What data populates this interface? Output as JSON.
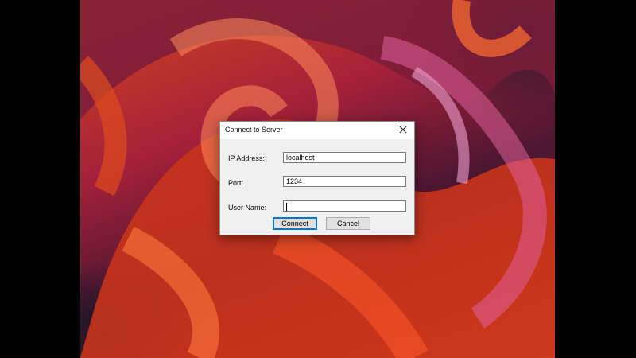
{
  "dialog": {
    "title": "Connect to Server",
    "fields": [
      {
        "label": "IP Address:",
        "value": "localhost"
      },
      {
        "label": "Port:",
        "value": "1234"
      },
      {
        "label": "User Name:",
        "value": ""
      }
    ],
    "buttons": {
      "connect": "Connect",
      "cancel": "Cancel"
    },
    "close_icon": "close-icon"
  },
  "colors": {
    "dialog_bg": "#f0f0f0",
    "titlebar_bg": "#ffffff",
    "default_button_border": "#0078d7",
    "desktop_letterbox": "#000000"
  }
}
